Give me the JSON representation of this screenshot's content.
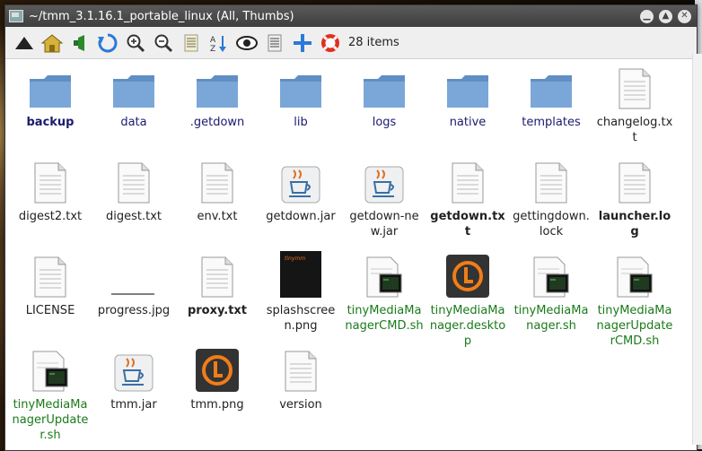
{
  "window": {
    "title": "~/tmm_3.1.16.1_portable_linux (All, Thumbs)",
    "controls": [
      "minimize",
      "maximize",
      "close"
    ]
  },
  "toolbar": {
    "buttons": [
      {
        "name": "up-arrow-icon"
      },
      {
        "name": "home-icon"
      },
      {
        "name": "back-icon"
      },
      {
        "name": "refresh-icon"
      },
      {
        "name": "zoom-in-icon"
      },
      {
        "name": "zoom-out-icon"
      },
      {
        "name": "list-view-icon"
      },
      {
        "name": "sort-icon"
      },
      {
        "name": "eye-icon"
      },
      {
        "name": "details-icon"
      },
      {
        "name": "plus-icon"
      },
      {
        "name": "help-icon"
      }
    ],
    "item_count": "28 items"
  },
  "files": [
    {
      "label": "backup",
      "type": "folder",
      "style": "dir bold"
    },
    {
      "label": "data",
      "type": "folder",
      "style": "dir"
    },
    {
      "label": ".getdown",
      "type": "folder",
      "style": "dir"
    },
    {
      "label": "lib",
      "type": "folder",
      "style": "dir"
    },
    {
      "label": "logs",
      "type": "folder",
      "style": "dir"
    },
    {
      "label": "native",
      "type": "folder",
      "style": "dir"
    },
    {
      "label": "templates",
      "type": "folder",
      "style": "dir"
    },
    {
      "label": "changelog.txt",
      "type": "text",
      "style": "plain"
    },
    {
      "label": "digest2.txt",
      "type": "text",
      "style": "plain"
    },
    {
      "label": "digest.txt",
      "type": "text",
      "style": "plain"
    },
    {
      "label": "env.txt",
      "type": "text",
      "style": "plain"
    },
    {
      "label": "getdown.jar",
      "type": "jar",
      "style": "plain"
    },
    {
      "label": "getdown-new.jar",
      "type": "jar",
      "style": "plain"
    },
    {
      "label": "getdown.txt",
      "type": "text",
      "style": "plain bold"
    },
    {
      "label": "gettingdown.lock",
      "type": "text",
      "style": "plain"
    },
    {
      "label": "launcher.log",
      "type": "text",
      "style": "plain bold"
    },
    {
      "label": "LICENSE",
      "type": "text",
      "style": "plain"
    },
    {
      "label": "progress.jpg",
      "type": "line",
      "style": "plain"
    },
    {
      "label": "proxy.txt",
      "type": "text",
      "style": "plain bold"
    },
    {
      "label": "splashscreen.png",
      "type": "splash",
      "style": "plain"
    },
    {
      "label": "tinyMediaManagerCMD.sh",
      "type": "script",
      "style": "exec"
    },
    {
      "label": "tinyMediaManager.desktop",
      "type": "tmm",
      "style": "exec"
    },
    {
      "label": "tinyMediaManager.sh",
      "type": "script",
      "style": "exec"
    },
    {
      "label": "tinyMediaManagerUpdaterCMD.sh",
      "type": "script",
      "style": "exec"
    },
    {
      "label": "tinyMediaManagerUpdater.sh",
      "type": "script",
      "style": "exec"
    },
    {
      "label": "tmm.jar",
      "type": "jar",
      "style": "plain"
    },
    {
      "label": "tmm.png",
      "type": "tmm",
      "style": "plain"
    },
    {
      "label": "version",
      "type": "text",
      "style": "plain"
    }
  ],
  "colors": {
    "folder": "#7aa7d8",
    "folder_text": "#1a1a6e",
    "exec_text": "#1a7a1a",
    "tmm_orange": "#f07d1a"
  },
  "splash_text": "tinymm"
}
